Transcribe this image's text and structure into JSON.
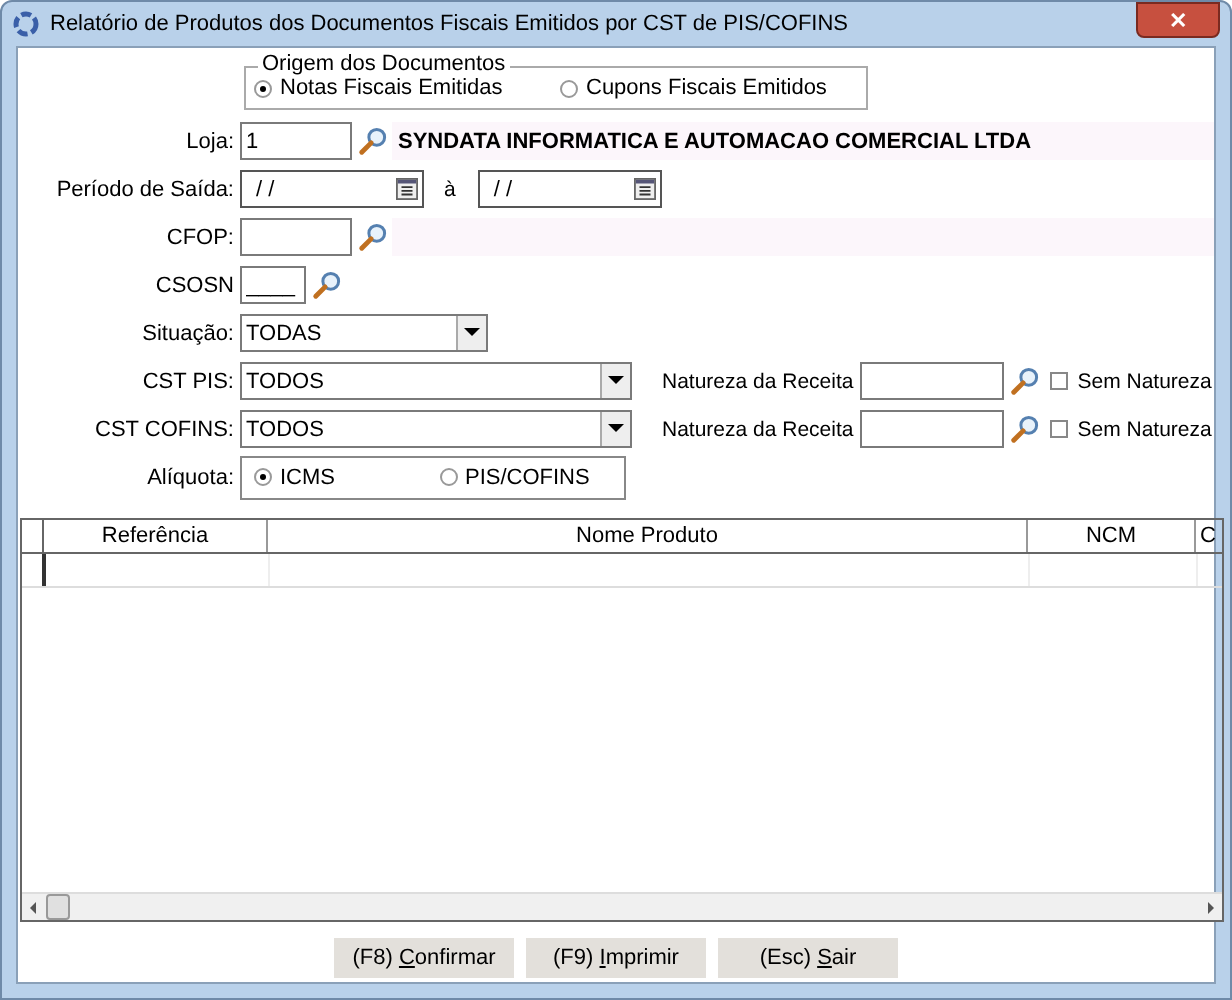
{
  "window": {
    "title": "Relatório de Produtos dos Documentos Fiscais Emitidos por CST de PIS/COFINS",
    "close": "✕"
  },
  "origem": {
    "title": "Origem dos Documentos",
    "options": [
      {
        "label": "Notas Fiscais Emitidas",
        "selected": true
      },
      {
        "label": "Cupons Fiscais Emitidos",
        "selected": false
      }
    ]
  },
  "loja": {
    "label": "Loja:",
    "value": "1",
    "name": "SYNDATA INFORMATICA E AUTOMACAO COMERCIAL LTDA"
  },
  "periodo": {
    "label": "Período de Saída:",
    "from": "/ /",
    "separator": "à",
    "to": "/ /"
  },
  "cfop": {
    "label": "CFOP:"
  },
  "csosn": {
    "label": "CSOSN",
    "value": "____"
  },
  "situacao": {
    "label": "Situação:",
    "value": "TODAS"
  },
  "cst_rows": [
    {
      "label": "CST PIS:",
      "value": "TODOS",
      "natureza_label": "Natureza da Receita",
      "checkbox": {
        "label": "Sem Natureza",
        "checked": false
      }
    },
    {
      "label": "CST COFINS:",
      "value": "TODOS",
      "natureza_label": "Natureza da Receita",
      "checkbox": {
        "label": "Sem Natureza",
        "checked": false
      }
    }
  ],
  "aliquota": {
    "label": "Alíquota:",
    "options": [
      {
        "label": "ICMS",
        "selected": true
      },
      {
        "label": "PIS/COFINS",
        "selected": false
      }
    ]
  },
  "table": {
    "columns": [
      "Referência",
      "Nome Produto",
      "NCM",
      "C"
    ]
  },
  "buttons": [
    {
      "prefix": "(F8) ",
      "accel": "C",
      "rest": "onfirmar"
    },
    {
      "prefix": "(F9) ",
      "accel": "I",
      "rest": "mprimir"
    },
    {
      "prefix": "(Esc) ",
      "accel": "S",
      "rest": "air"
    }
  ]
}
